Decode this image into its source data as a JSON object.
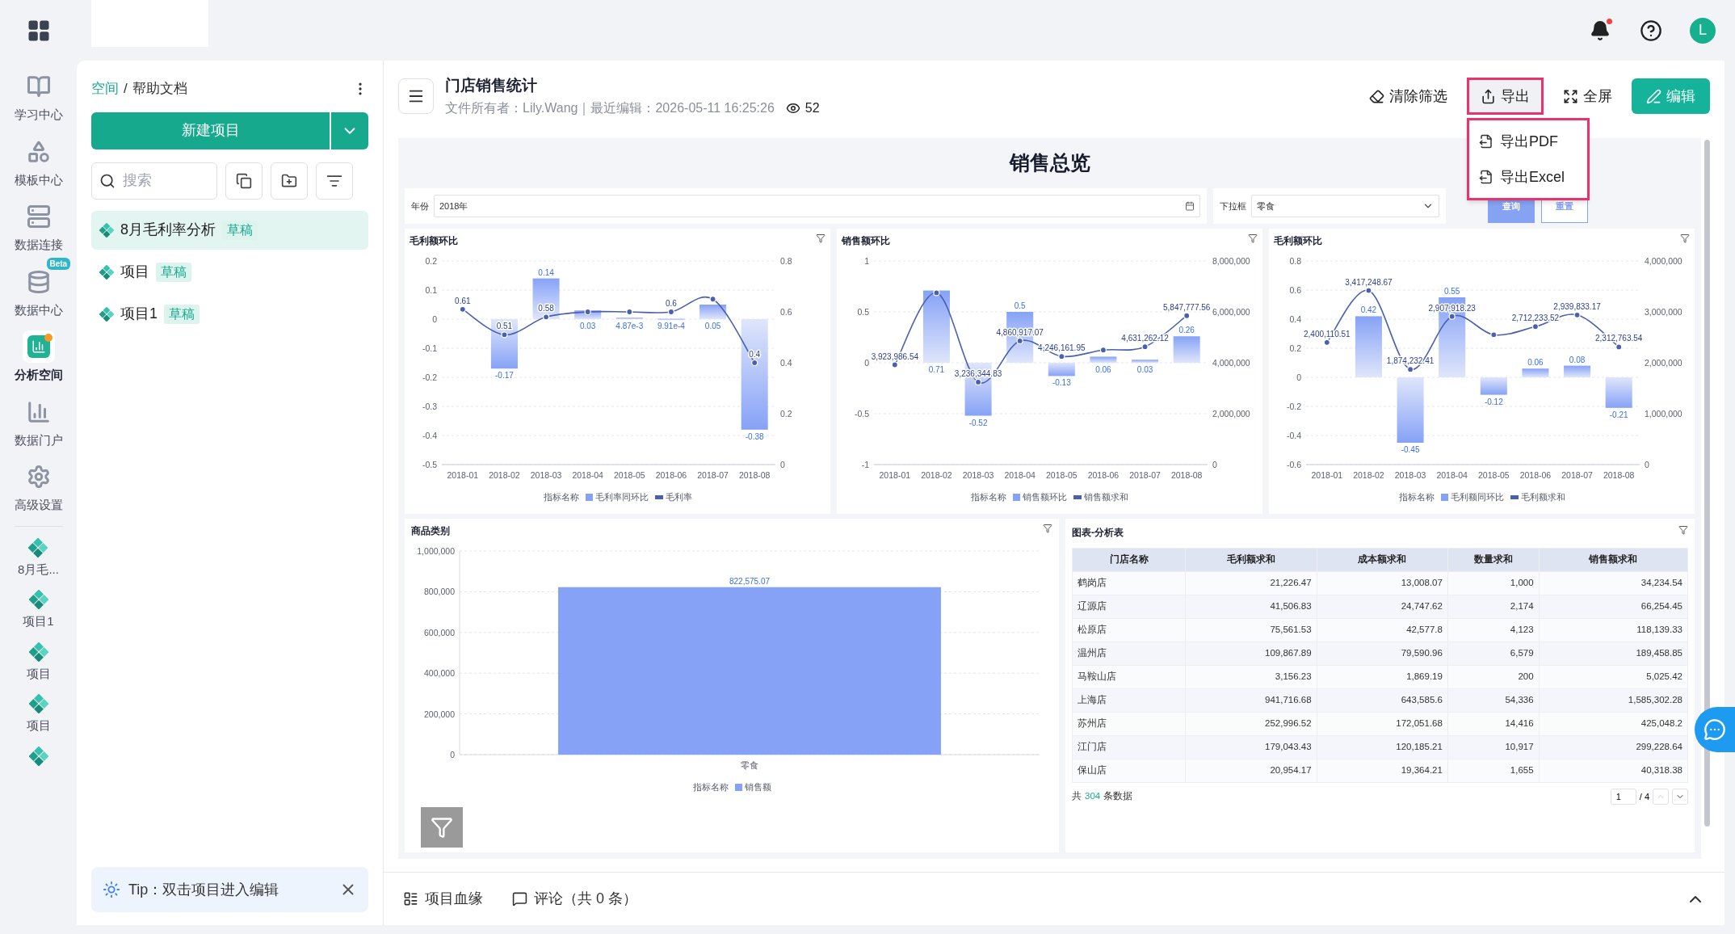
{
  "top_bar": {
    "has_unread": true,
    "avatar": "L"
  },
  "rail": {
    "items": [
      {
        "label": "学习中心",
        "selected": false
      },
      {
        "label": "模板中心",
        "selected": false
      },
      {
        "label": "数据连接",
        "selected": false
      },
      {
        "label": "数据中心",
        "selected": false,
        "badge": "Beta"
      },
      {
        "label": "分析空间",
        "selected": true
      },
      {
        "label": "数据门户",
        "selected": false
      },
      {
        "label": "高级设置",
        "selected": false
      }
    ],
    "projects": [
      "8月毛...",
      "项目1",
      "项目",
      "项目"
    ]
  },
  "panel": {
    "breadcrumb_link": "空间",
    "breadcrumb_separator": "/",
    "breadcrumb_current": "帮助文档",
    "new_button": "新建项目",
    "search": {
      "placeholder": "搜索"
    },
    "projects": [
      {
        "name": "8月毛利率分析",
        "status": "草稿",
        "selected": true
      },
      {
        "name": "项目",
        "status": "草稿",
        "selected": false
      },
      {
        "name": "项目1",
        "status": "草稿",
        "selected": false
      }
    ],
    "tip": "Tip：双击项目进入编辑"
  },
  "report": {
    "title": "门店销售统计",
    "meta": "文件所有者：Lily.Wang｜最近编辑：2026-05-11 16:25:26",
    "views": "52",
    "actions": [
      {
        "label": "清除筛选",
        "kind": "plain"
      },
      {
        "label": "导出",
        "kind": "highlighted"
      },
      {
        "label": "全屏",
        "kind": "plain"
      },
      {
        "label": "编辑",
        "kind": "primary"
      }
    ],
    "export_menu": {
      "open": true,
      "items": [
        "导出PDF",
        "导出Excel"
      ]
    }
  },
  "dashboard": {
    "title": "销售总览",
    "filters": [
      {
        "label": "年份",
        "value": "2018年",
        "kind": "date"
      },
      {
        "label": "下拉框",
        "value": "零食",
        "kind": "select"
      }
    ],
    "query_button": "查询",
    "reset_button": "重置",
    "charts": [
      {
        "legend_title": "指标名称",
        "bars": {
          "chart_data": {
            "type": "bar",
            "title": "毛利额环比",
            "ylim": [
              -0.5,
              0.2
            ],
            "yticks": [
              -0.5,
              -0.4,
              -0.3,
              -0.2,
              -0.1,
              0,
              0.1,
              0.2
            ],
            "grid": true,
            "data_labels": true,
            "series": [
              {
                "name": "毛利率同环比",
                "color": "#86a2f6",
                "values": [
                  null,
                  -0.17,
                  0.14,
                  0.03,
                  0.00487,
                  0.000991,
                  0.05,
                  -0.38
                ],
                "value_labels": [
                  null,
                  "-0.17",
                  "0.14",
                  "0.03",
                  "4.87e-3",
                  "9.91e-4",
                  "0.05",
                  "-0.38"
                ]
              }
            ]
          }
        },
        "line": {
          "chart_data": {
            "type": "line",
            "categories": [
              "2018-01",
              "2018-02",
              "2018-03",
              "2018-04",
              "2018-05",
              "2018-06",
              "2018-07",
              "2018-08"
            ],
            "ylim": [
              0,
              0.8
            ],
            "yticks": [
              0,
              0.2,
              0.4,
              0.6,
              0.8
            ],
            "series": [
              {
                "name": "毛利率",
                "color": "#4a5fb0",
                "marker": true,
                "values": [
                  0.61,
                  0.51,
                  0.58,
                  0.6,
                  0.6,
                  0.6,
                  0.65,
                  0.4
                ]
              }
            ],
            "annotations": [
              {
                "x": "2018-01",
                "y": 0.61,
                "text": "0.61"
              },
              {
                "x": "2018-02",
                "y": 0.51,
                "text": "0.51"
              },
              {
                "x": "2018-03",
                "y": 0.58,
                "text": "0.58"
              },
              {
                "x": "2018-06",
                "y": 0.6,
                "text": "0.6"
              },
              {
                "x": "2018-08",
                "y": 0.4,
                "text": "0.4"
              }
            ]
          }
        }
      },
      {
        "legend_title": "指标名称",
        "bars": {
          "chart_data": {
            "type": "bar",
            "title": "销售额环比",
            "ylim": [
              -1,
              1
            ],
            "yticks": [
              -1,
              -0.5,
              0,
              0.5,
              1
            ],
            "grid": true,
            "data_labels": true,
            "series": [
              {
                "name": "销售额环比",
                "color": "#86a2f6",
                "values": [
                  null,
                  0.71,
                  -0.52,
                  0.5,
                  -0.13,
                  0.06,
                  0.03,
                  0.26
                ],
                "value_labels": [
                  null,
                  "0.71",
                  "-0.52",
                  "0.5",
                  "-0.13",
                  "0.06",
                  "0.03",
                  "0.26"
                ]
              }
            ]
          }
        },
        "line": {
          "chart_data": {
            "type": "line",
            "categories": [
              "2018-01",
              "2018-02",
              "2018-03",
              "2018-04",
              "2018-05",
              "2018-06",
              "2018-07",
              "2018-08"
            ],
            "ylim": [
              0,
              8000000
            ],
            "yticks": [
              {
                "value": 0,
                "label": "0"
              },
              {
                "value": 2000000,
                "label": "2,000,000"
              },
              {
                "value": 4000000,
                "label": "4,000,000"
              },
              {
                "value": 6000000,
                "label": "6,000,000"
              },
              {
                "value": 8000000,
                "label": "8,000,000"
              }
            ],
            "series": [
              {
                "name": "销售额求和",
                "color": "#4a5fb0",
                "marker": true,
                "values": [
                  3920000,
                  6750000,
                  3240000,
                  4860000,
                  4250000,
                  4500000,
                  4630000,
                  5850000
                ]
              }
            ],
            "annotations": [
              {
                "x": "2018-01",
                "y": 3920000,
                "text": "3,923,986.54"
              },
              {
                "x": "2018-03",
                "y": 3240000,
                "text": "3,236,344.83"
              },
              {
                "x": "2018-04",
                "y": 4860000,
                "text": "4,860,917.07"
              },
              {
                "x": "2018-05",
                "y": 4250000,
                "text": "4,246,161.95"
              },
              {
                "x": "2018-07",
                "y": 4630000,
                "text": "4,631,262.12"
              },
              {
                "x": "2018-08",
                "y": 5850000,
                "text": "5,847,777.56"
              }
            ]
          }
        }
      },
      {
        "legend_title": "指标名称",
        "bars": {
          "chart_data": {
            "type": "bar",
            "title": "毛利额环比",
            "ylim": [
              -0.6,
              0.8
            ],
            "yticks": [
              -0.6,
              -0.4,
              -0.2,
              0,
              0.2,
              0.4,
              0.6,
              0.8
            ],
            "grid": true,
            "data_labels": true,
            "series": [
              {
                "name": "毛利额同环比",
                "color": "#86a2f6",
                "values": [
                  null,
                  0.42,
                  -0.45,
                  0.55,
                  -0.12,
                  0.06,
                  0.08,
                  -0.21
                ],
                "value_labels": [
                  null,
                  "0.42",
                  "-0.45",
                  "0.55",
                  "-0.12",
                  "0.06",
                  "0.08",
                  "-0.21"
                ]
              }
            ]
          }
        },
        "line": {
          "chart_data": {
            "type": "line",
            "categories": [
              "2018-01",
              "2018-02",
              "2018-03",
              "2018-04",
              "2018-05",
              "2018-06",
              "2018-07",
              "2018-08"
            ],
            "ylim": [
              0,
              4000000
            ],
            "yticks": [
              {
                "value": 0,
                "label": "0"
              },
              {
                "value": 1000000,
                "label": "1,000,000"
              },
              {
                "value": 2000000,
                "label": "2,000,000"
              },
              {
                "value": 3000000,
                "label": "3,000,000"
              },
              {
                "value": 4000000,
                "label": "4,000,000"
              }
            ],
            "series": [
              {
                "name": "毛利额求和",
                "color": "#4a5fb0",
                "marker": true,
                "values": [
                  2400000,
                  3420000,
                  1870000,
                  2910000,
                  2550000,
                  2710000,
                  2940000,
                  2310000
                ]
              }
            ],
            "annotations": [
              {
                "x": "2018-01",
                "y": 2400000,
                "text": "2,400,110.51"
              },
              {
                "x": "2018-02",
                "y": 3420000,
                "text": "3,417,248.67"
              },
              {
                "x": "2018-03",
                "y": 1870000,
                "text": "1,874,232.41"
              },
              {
                "x": "2018-04",
                "y": 2910000,
                "text": "2,907,918.23"
              },
              {
                "x": "2018-06",
                "y": 2710000,
                "text": "2,712,233.52"
              },
              {
                "x": "2018-07",
                "y": 2940000,
                "text": "2,939,833.17"
              },
              {
                "x": "2018-08",
                "y": 2310000,
                "text": "2,312,763.54"
              }
            ]
          }
        }
      }
    ],
    "bar_chart": {
      "legend_title": "指标名称",
      "chart_data": {
        "type": "bar",
        "title": "商品类别",
        "categories": [
          "零食"
        ],
        "ylim": [
          0,
          1000000
        ],
        "yticks": [
          {
            "value": 0,
            "label": "0"
          },
          {
            "value": 200000,
            "label": "200,000"
          },
          {
            "value": 400000,
            "label": "400,000"
          },
          {
            "value": 600000,
            "label": "600,000"
          },
          {
            "value": 800000,
            "label": "800,000"
          },
          {
            "value": 1000000,
            "label": "1,000,000"
          }
        ],
        "grid": true,
        "data_labels": true,
        "series": [
          {
            "name": "销售额",
            "color": "#86a2f6",
            "values": [
              822575.07
            ],
            "value_labels": [
              "822,575.07"
            ]
          }
        ]
      }
    },
    "table": {
      "title": "图表-分析表",
      "columns": [
        "门店名称",
        "毛利额求和",
        "成本额求和",
        "数量求和",
        "销售额求和"
      ],
      "rows": [
        [
          "鹤岗店",
          "21,226.47",
          "13,008.07",
          "1,000",
          "34,234.54"
        ],
        [
          "辽源店",
          "41,506.83",
          "24,747.62",
          "2,174",
          "66,254.45"
        ],
        [
          "松原店",
          "75,561.53",
          "42,577.8",
          "4,123",
          "118,139.33"
        ],
        [
          "温州店",
          "109,867.89",
          "79,590.96",
          "6,579",
          "189,458.85"
        ],
        [
          "马鞍山店",
          "3,156.23",
          "1,869.19",
          "200",
          "5,025.42"
        ],
        [
          "上海店",
          "941,716.68",
          "643,585.6",
          "54,336",
          "1,585,302.28"
        ],
        [
          "苏州店",
          "252,996.52",
          "172,051.68",
          "14,416",
          "425,048.2"
        ],
        [
          "江门店",
          "179,043.43",
          "120,185.21",
          "10,917",
          "299,228.64"
        ],
        [
          "保山店",
          "20,954.17",
          "19,364.21",
          "1,655",
          "40,318.38"
        ]
      ],
      "total_prefix": "共",
      "total_count": "304",
      "total_suffix": "条数据",
      "page": "1",
      "of_pages": "/ 4",
      "can_prev": false
    }
  },
  "bottom_bar": {
    "tabs": [
      "项目血缘",
      "评论（共 0 条）"
    ]
  }
}
